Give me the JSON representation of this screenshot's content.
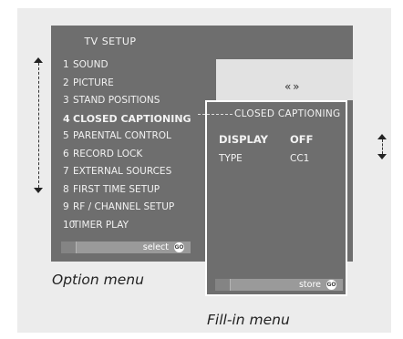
{
  "option_menu": {
    "title": "TV  SETUP",
    "items": [
      {
        "num": "1",
        "label": "SOUND"
      },
      {
        "num": "2",
        "label": "PICTURE"
      },
      {
        "num": "3",
        "label": "STAND POSITIONS"
      },
      {
        "num": "4",
        "label": "CLOSED CAPTIONING"
      },
      {
        "num": "5",
        "label": "PARENTAL CONTROL"
      },
      {
        "num": "6",
        "label": "RECORD LOCK"
      },
      {
        "num": "7",
        "label": "EXTERNAL SOURCES"
      },
      {
        "num": "8",
        "label": "FIRST TIME SETUP"
      },
      {
        "num": "9",
        "label": "RF / CHANNEL SETUP"
      },
      {
        "num": "10",
        "label": "TIMER PLAY"
      }
    ],
    "active_index": 3,
    "status_label": "select",
    "go_label": "GO",
    "caption": "Option menu"
  },
  "fill_in_menu": {
    "title": "CLOSED  CAPTIONING",
    "fields": [
      {
        "label": "DISPLAY",
        "value": "OFF"
      },
      {
        "label": "TYPE",
        "value": "CC1"
      }
    ],
    "status_label": "store",
    "go_label": "GO",
    "caption": "Fill-in menu"
  },
  "sub_panel_arrows": "« »",
  "colors": {
    "panel": "#6e6e6e",
    "frame": "#ececec",
    "text_light": "#f2f2f2"
  }
}
